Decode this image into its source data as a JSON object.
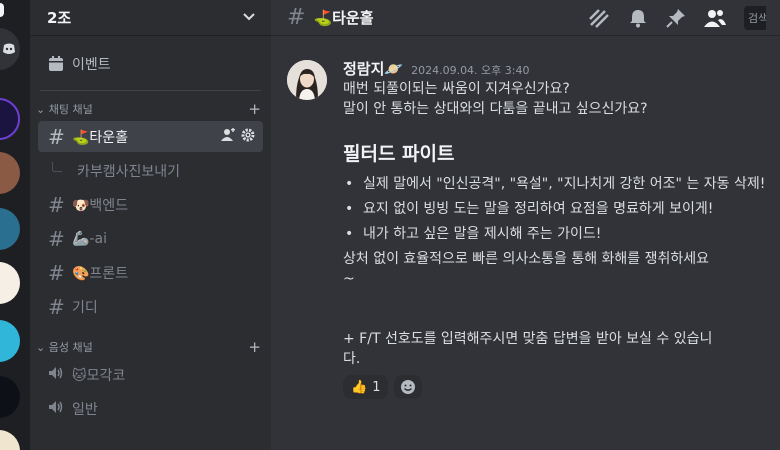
{
  "server": {
    "name": "2조",
    "events_label": "이벤트",
    "categories": {
      "text": "채팅 채널",
      "voice": "음성 채널"
    },
    "channels": [
      {
        "name": "⛳타운홀",
        "active": true
      },
      {
        "name": "카부캠사진보내기",
        "thread": true
      },
      {
        "name": "🐶백엔드"
      },
      {
        "name": "🦾-ai"
      },
      {
        "name": "🎨프론트"
      },
      {
        "name": "기디"
      }
    ],
    "voice_channels": [
      {
        "name": "🐱모각코"
      },
      {
        "name": "일반"
      }
    ]
  },
  "topbar": {
    "channel_title": "⛳타운홀",
    "search_placeholder": "검색하기"
  },
  "message": {
    "author": "정람지🪐",
    "timestamp": "2024.09.04. 오후 3:40",
    "intro": [
      "매번 되풀이되는 싸움이 지겨우신가요?",
      "말이 안 통하는 상대와의 다툼을 끝내고 싶으신가요?"
    ],
    "heading": "필터드 파이트",
    "bullets": [
      "실제 말에서 \"인신공격\", \"욕설\", \"지나치게 강한 어조\" 는 자동 삭제!",
      "요지 없이 빙빙 도는 말을 정리하여 요점을 명료하게 보이게!",
      "내가 하고 싶은 말을 제시해 주는 가이드!"
    ],
    "closing": [
      "상처 없이 효율적으로 빠른 의사소통을 통해 화해를 쟁취하세요",
      "~"
    ],
    "footer": [
      "+ F/T 선호도를 입력해주시면 맞춤 답변을 받아 보실 수 있습니",
      "다."
    ],
    "reactions": [
      {
        "emoji": "👍",
        "count": "1"
      }
    ]
  },
  "colors": {
    "bg_main": "#313338",
    "bg_sidebar": "#2b2d31",
    "bg_rail": "#1e1f22",
    "active_channel": "#404249"
  }
}
